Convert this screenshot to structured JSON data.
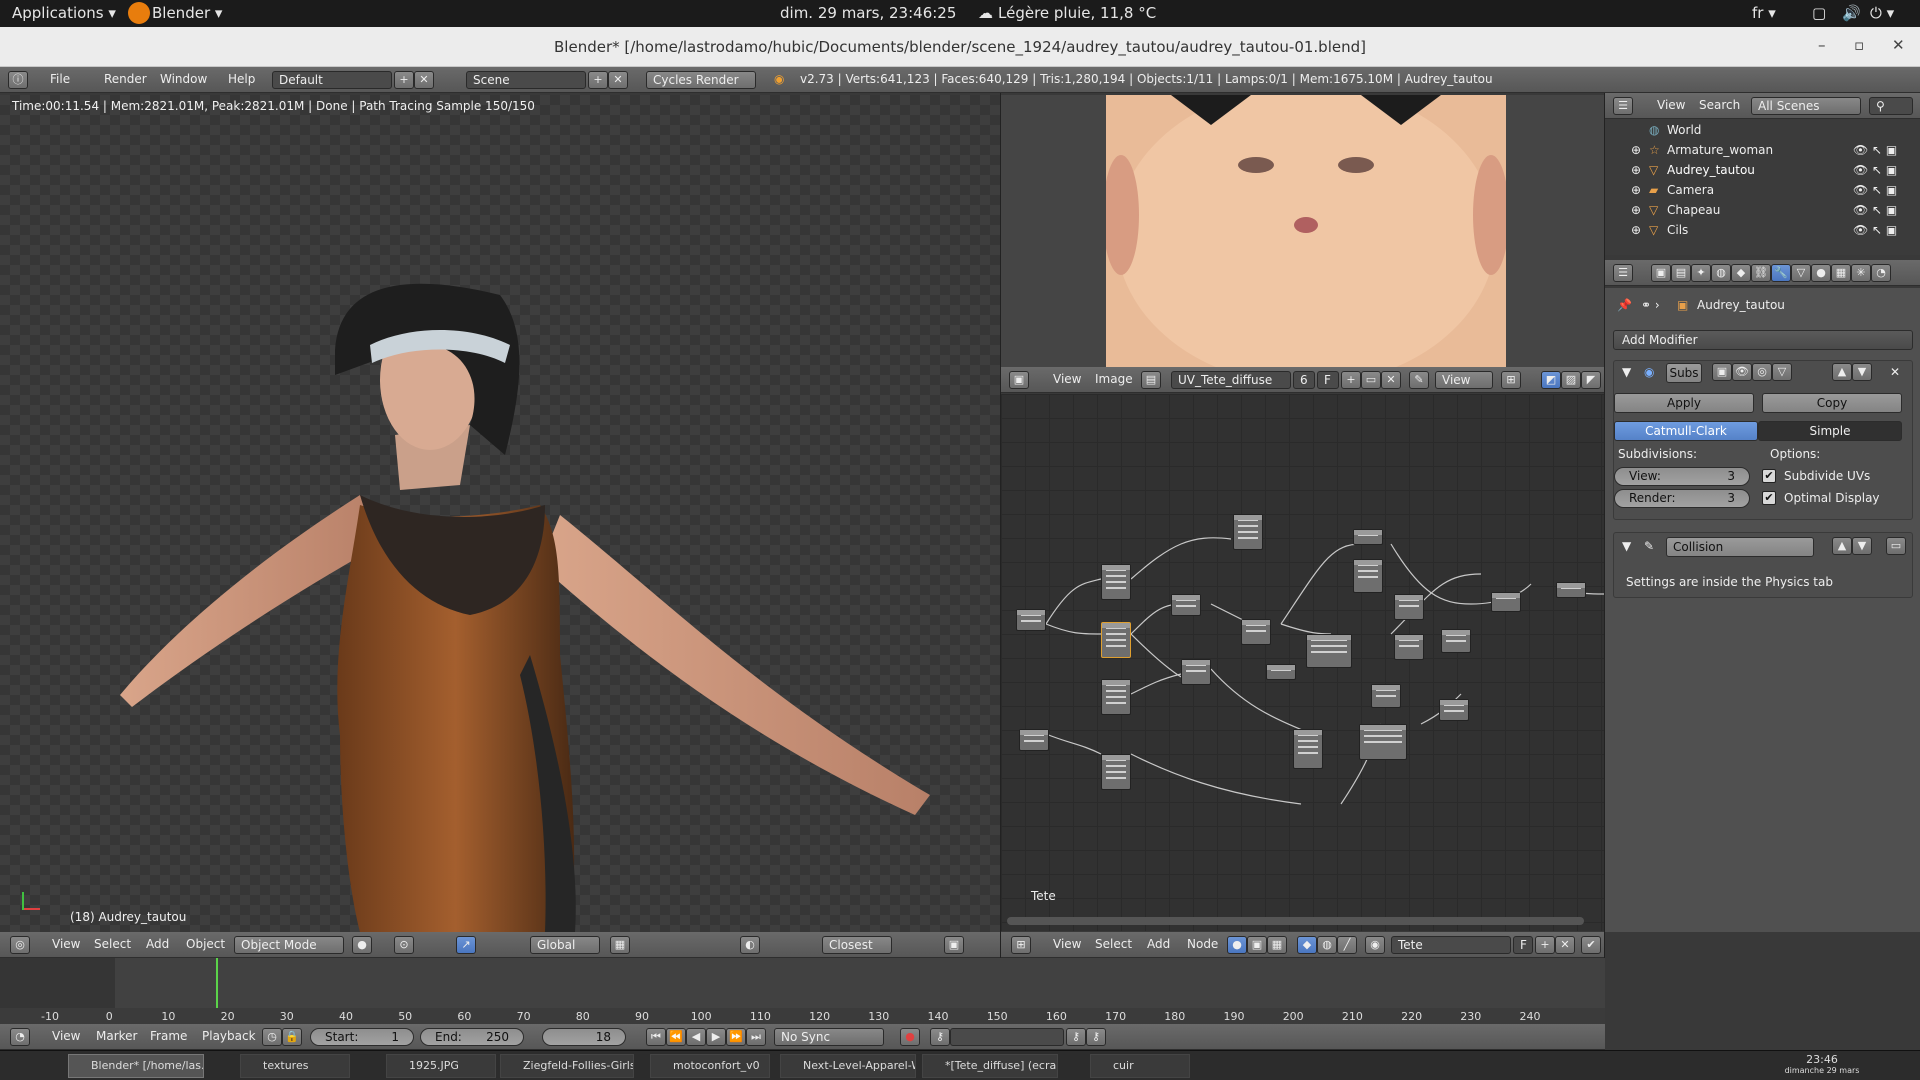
{
  "topbar": {
    "applications": "Applications",
    "app_menu": "Blender",
    "datetime": "dim. 29 mars, 23:46:25",
    "weather": "Légère pluie, 11,8 °C",
    "lang": "fr"
  },
  "window": {
    "title": "Blender* [/home/lastrodamo/hubic/Documents/blender/scene_1924/audrey_tautou/audrey_tautou-01.blend]"
  },
  "info_header": {
    "menus": [
      "File",
      "Render",
      "Window",
      "Help"
    ],
    "layout": "Default",
    "scene": "Scene",
    "engine": "Cycles Render",
    "stats": "v2.73 | Verts:641,123 | Faces:640,129 | Tris:1,280,194 | Objects:1/11 | Lamps:0/1 | Mem:1675.10M | Audrey_tautou"
  },
  "viewport": {
    "status": "Time:00:11.54 | Mem:2821.01M, Peak:2821.01M | Done | Path Tracing Sample 150/150",
    "object_label": "(18) Audrey_tautou",
    "header": {
      "menus": [
        "View",
        "Select",
        "Add",
        "Object"
      ],
      "mode": "Object Mode",
      "orientation": "Global",
      "snap": "Closest"
    }
  },
  "image_editor": {
    "menus": [
      "View",
      "Image"
    ],
    "image_name": "UV_Tete_diffuse",
    "users": "6",
    "fake": "F",
    "view_mode": "View"
  },
  "node_editor": {
    "label": "Tete",
    "menus": [
      "View",
      "Select",
      "Add",
      "Node"
    ],
    "material": "Tete",
    "fake": "F"
  },
  "outliner": {
    "menus": [
      "View",
      "Search"
    ],
    "filter": "All Scenes",
    "items": [
      "World",
      "Armature_woman",
      "Audrey_tautou",
      "Camera",
      "Chapeau",
      "Cils"
    ]
  },
  "properties": {
    "object": "Audrey_tautou",
    "add_modifier": "Add Modifier",
    "modifier1": {
      "name": "Subs",
      "apply": "Apply",
      "copy": "Copy",
      "type_a": "Catmull-Clark",
      "type_b": "Simple",
      "subdivisions_label": "Subdivisions:",
      "options_label": "Options:",
      "view_label": "View:",
      "view_value": "3",
      "render_label": "Render:",
      "render_value": "3",
      "opt1": "Subdivide UVs",
      "opt2": "Optimal Display"
    },
    "modifier2": {
      "name": "Collision",
      "note": "Settings are inside the Physics tab"
    }
  },
  "timeline": {
    "menus": [
      "View",
      "Marker",
      "Frame",
      "Playback"
    ],
    "start_label": "Start:",
    "start": "1",
    "end_label": "End:",
    "end": "250",
    "current": "18",
    "sync": "No Sync",
    "ticks": [
      "-10",
      "0",
      "10",
      "20",
      "30",
      "40",
      "50",
      "60",
      "70",
      "80",
      "90",
      "100",
      "110",
      "120",
      "130",
      "140",
      "150",
      "160",
      "170",
      "180",
      "190",
      "200",
      "210",
      "220",
      "230",
      "240"
    ]
  },
  "taskbar": {
    "tasks": [
      "Blender* [/home/las...",
      "textures",
      "1925.JPG",
      "Ziegfeld-Follies-Girls...",
      "motoconfort_v0",
      "Next-Level-Apparel-W...",
      "*[Tete_diffuse] (ecra...",
      "cuir"
    ],
    "clock_time": "23:46",
    "clock_date": "dimanche 29 mars"
  }
}
